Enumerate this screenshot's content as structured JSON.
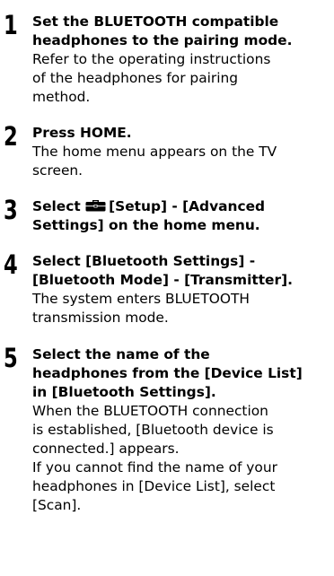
{
  "steps": [
    {
      "number": "1",
      "title": [
        "Set the BLUETOOTH compatible",
        "headphones to the pairing mode."
      ],
      "desc": [
        "Refer to the operating instructions",
        "of the headphones for pairing",
        "method."
      ]
    },
    {
      "number": "2",
      "title": [
        "Press HOME."
      ],
      "desc": [
        "The home menu appears on the TV",
        "screen."
      ]
    },
    {
      "number": "3",
      "title_icon": "toolbox-icon",
      "title": [
        "Select ",
        "[Setup] - [Advanced",
        "Settings] on the home menu."
      ],
      "desc": []
    },
    {
      "number": "4",
      "title": [
        "Select [Bluetooth Settings] -",
        "[Bluetooth Mode] - [Transmitter]."
      ],
      "desc": [
        "The system enters BLUETOOTH",
        "transmission mode."
      ]
    },
    {
      "number": "5",
      "title": [
        "Select the name of the",
        "headphones from the [Device List]",
        "in [Bluetooth Settings]."
      ],
      "desc": [
        "When the BLUETOOTH connection",
        "is established, [Bluetooth device is",
        "connected.] appears.",
        "If you cannot find the name of your",
        "headphones in [Device List], select",
        "[Scan]."
      ]
    }
  ]
}
